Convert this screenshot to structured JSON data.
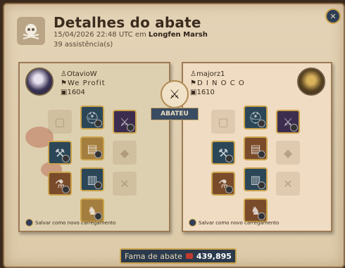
{
  "header": {
    "title": "Detalhes do abate",
    "datetime": "15/04/2026 22:48 UTC em",
    "location": "Longfen Marsh",
    "assists": "39 assistência(s)"
  },
  "killer": {
    "name": "OtavioW",
    "guild": "We Profit",
    "item_power": "1604",
    "save_label": "Salvar como novo carregamento"
  },
  "victim": {
    "name": "majorz1",
    "guild": "D I N O C O",
    "item_power": "1610",
    "save_label": "Salvar como novo carregamento"
  },
  "banner": "ABATEU",
  "fame": {
    "label": "Fama de abate",
    "value": "439,895"
  },
  "colors": {
    "rarity_gold": "#caa24a",
    "accent_navy": "#2b3a4c"
  }
}
